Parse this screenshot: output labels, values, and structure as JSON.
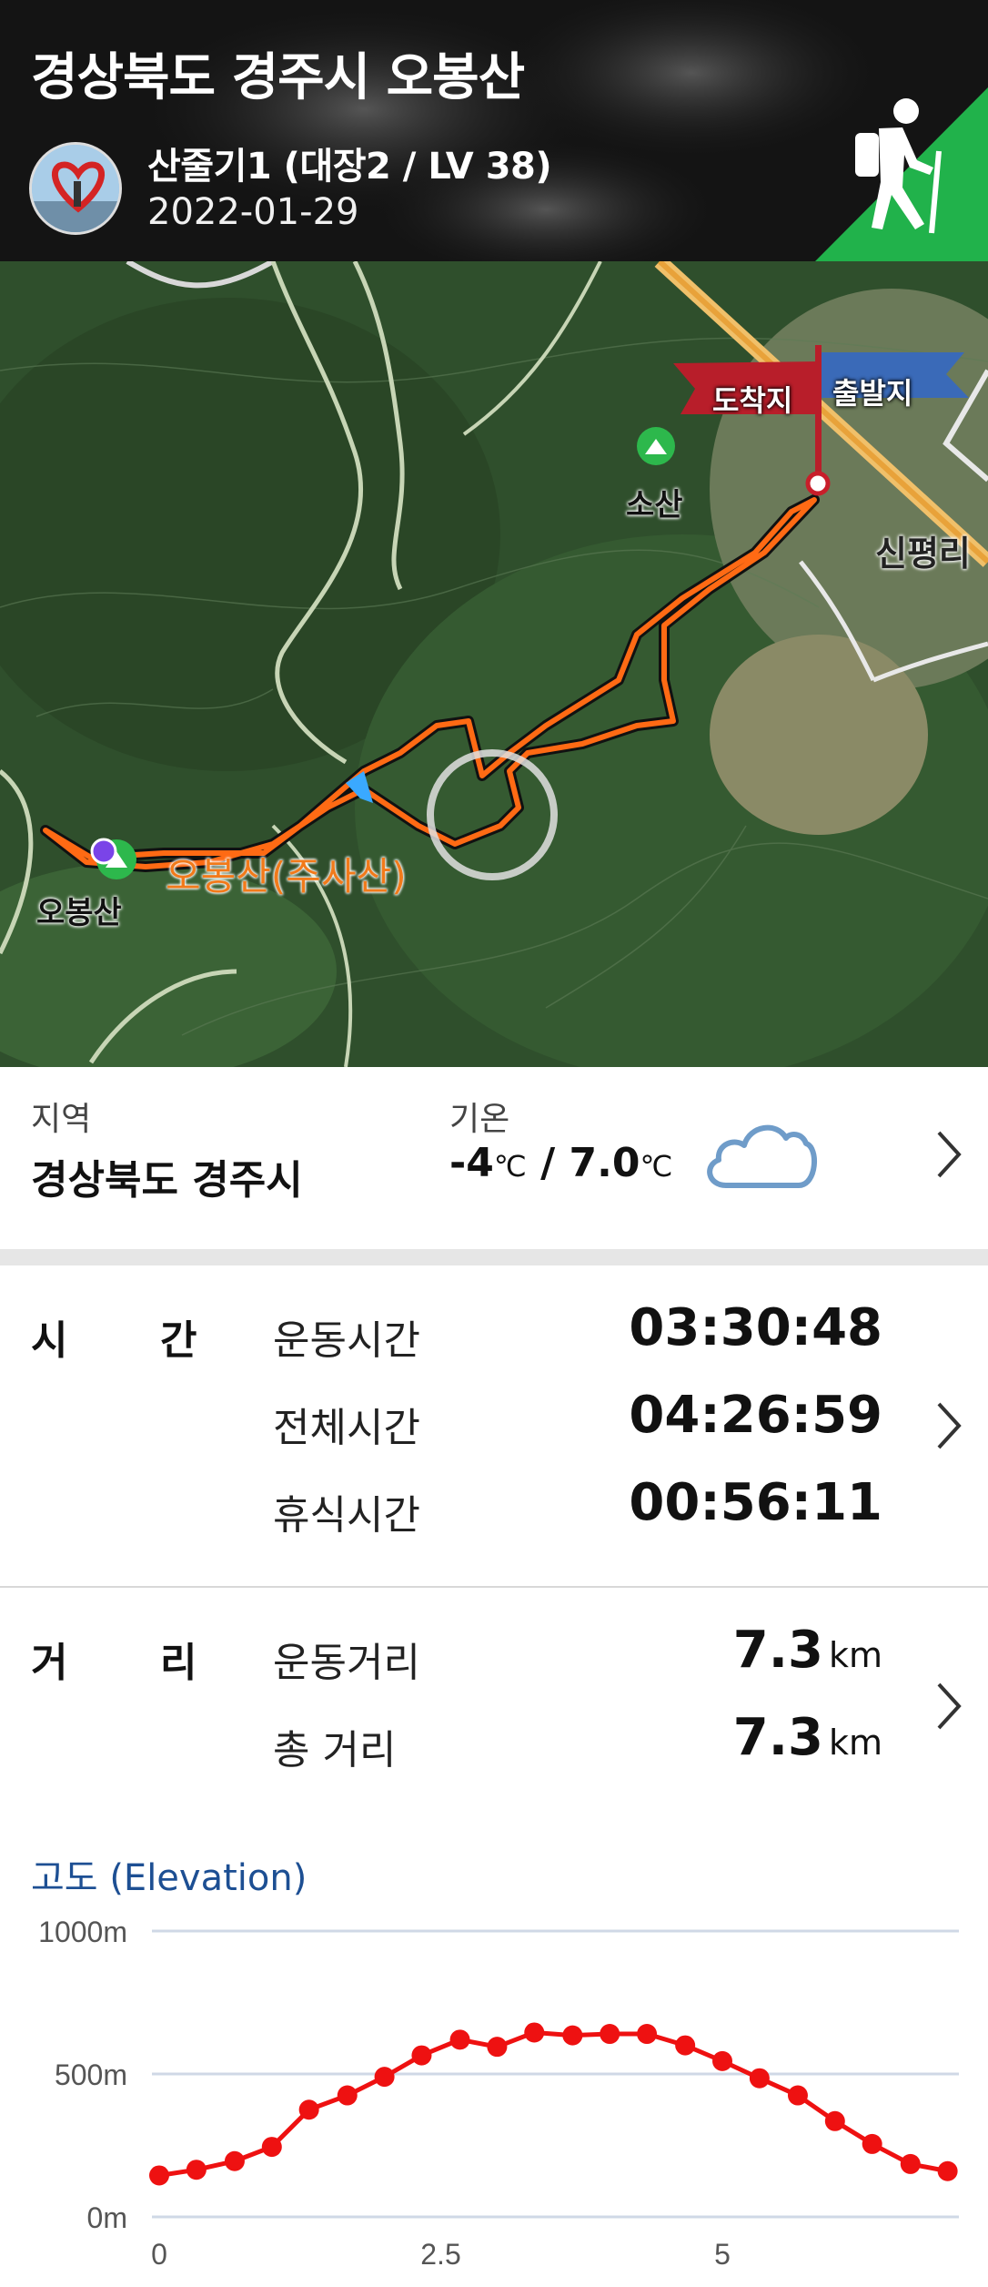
{
  "header": {
    "title": "경상북도 경주시 오봉산",
    "user": "산줄기1 (대장2 / LV 38)",
    "date": "2022-01-29"
  },
  "map": {
    "arrival_flag": "도착지",
    "start_flag": "출발지",
    "place_sosan": "소산",
    "place_sinpyeong": "신평리",
    "place_obongsan": "오봉산",
    "route_label": "오봉산(주사산)"
  },
  "info": {
    "region_label": "지역",
    "region_value": "경상북도 경주시",
    "temp_label": "기온",
    "temp_low": "-4",
    "temp_high": "7.0",
    "temp_unit": "℃",
    "weather_icon": "cloud-icon"
  },
  "time": {
    "heading_1": "시",
    "heading_2": "간",
    "rows": [
      {
        "label": "운동시간",
        "value": "03:30:48"
      },
      {
        "label": "전체시간",
        "value": "04:26:59"
      },
      {
        "label": "휴식시간",
        "value": "00:56:11"
      }
    ]
  },
  "distance": {
    "heading_1": "거",
    "heading_2": "리",
    "rows": [
      {
        "label": "운동거리",
        "value": "7.3",
        "unit": "km"
      },
      {
        "label": "총 거리",
        "value": "7.3",
        "unit": "km"
      }
    ]
  },
  "elevation": {
    "title": "고도 (Elevation)"
  },
  "chart_data": {
    "type": "line",
    "title": "고도 (Elevation)",
    "x": [
      0,
      0.33,
      0.67,
      1.0,
      1.33,
      1.67,
      2.0,
      2.33,
      2.67,
      3.0,
      3.33,
      3.67,
      4.0,
      4.33,
      4.67,
      5.0,
      5.33,
      5.67,
      6.0,
      6.33,
      6.67,
      7.0
    ],
    "series": [
      {
        "values": [
          145,
          165,
          195,
          245,
          375,
          425,
          490,
          565,
          620,
          595,
          645,
          635,
          640,
          640,
          600,
          545,
          485,
          425,
          335,
          255,
          185,
          160
        ]
      }
    ],
    "xlim": [
      0,
      7.1
    ],
    "ylim": [
      0,
      1000
    ],
    "xticks": [
      "0",
      "2.5",
      "5"
    ],
    "yticks": [
      "0m",
      "500m",
      "1000m"
    ],
    "color": "#ee1111",
    "grid": true
  }
}
